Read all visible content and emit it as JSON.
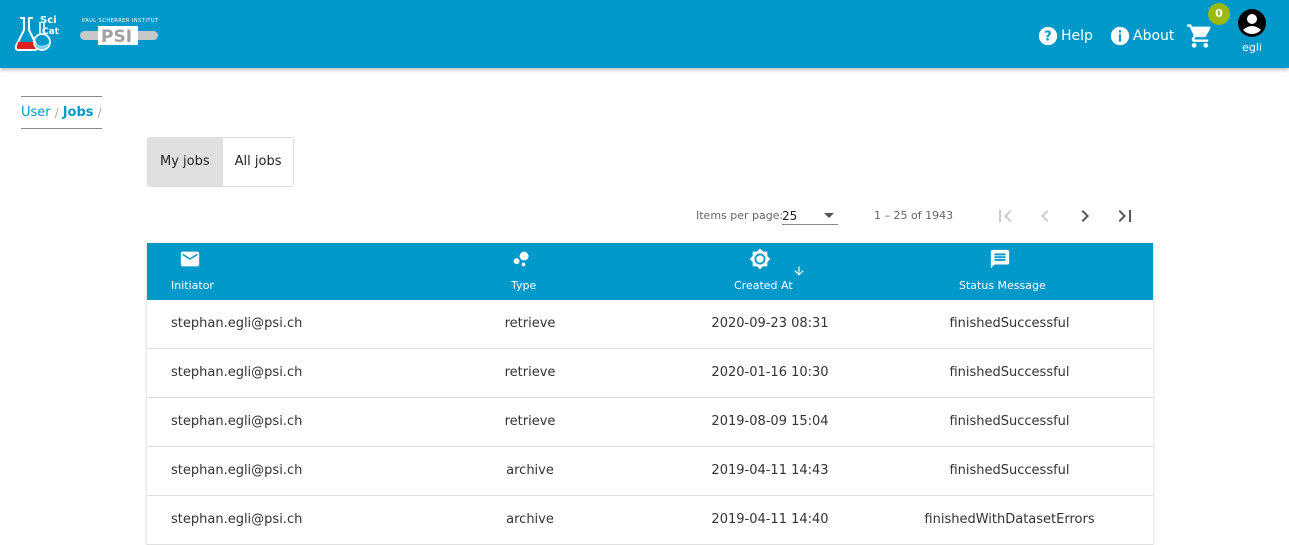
{
  "header": {
    "logo_scicat": "SciCat",
    "logo_psi_tagline": "PAUL SCHERRER INSTITUT",
    "logo_psi": "PSI",
    "help_label": "Help",
    "about_label": "About",
    "cart_count": "0",
    "username": "egli",
    "colors": {
      "bar": "#0199ca",
      "badge": "#9ab90b"
    }
  },
  "breadcrumb": {
    "items": [
      {
        "label": "User"
      },
      {
        "label": "Jobs"
      }
    ],
    "separator": "/"
  },
  "view_toggle": {
    "options": [
      {
        "label": "My jobs",
        "selected": true
      },
      {
        "label": "All jobs",
        "selected": false
      }
    ]
  },
  "paginator": {
    "items_per_page_label": "Items per page:",
    "items_per_page_value": "25",
    "range_label": "1 – 25 of 1943"
  },
  "table": {
    "columns": [
      {
        "label": "Initiator",
        "icon": "email-icon"
      },
      {
        "label": "Type",
        "icon": "bubble-chart-icon"
      },
      {
        "label": "Created At",
        "icon": "brightness-icon",
        "sorted": "descending"
      },
      {
        "label": "Status Message",
        "icon": "message-icon"
      }
    ],
    "rows": [
      {
        "initiator": "stephan.egli@psi.ch",
        "type": "retrieve",
        "created_at": "2020-09-23 08:31",
        "status": "finishedSuccessful"
      },
      {
        "initiator": "stephan.egli@psi.ch",
        "type": "retrieve",
        "created_at": "2020-01-16 10:30",
        "status": "finishedSuccessful"
      },
      {
        "initiator": "stephan.egli@psi.ch",
        "type": "retrieve",
        "created_at": "2019-08-09 15:04",
        "status": "finishedSuccessful"
      },
      {
        "initiator": "stephan.egli@psi.ch",
        "type": "archive",
        "created_at": "2019-04-11 14:43",
        "status": "finishedSuccessful"
      },
      {
        "initiator": "stephan.egli@psi.ch",
        "type": "archive",
        "created_at": "2019-04-11 14:40",
        "status": "finishedWithDatasetErrors"
      }
    ]
  }
}
